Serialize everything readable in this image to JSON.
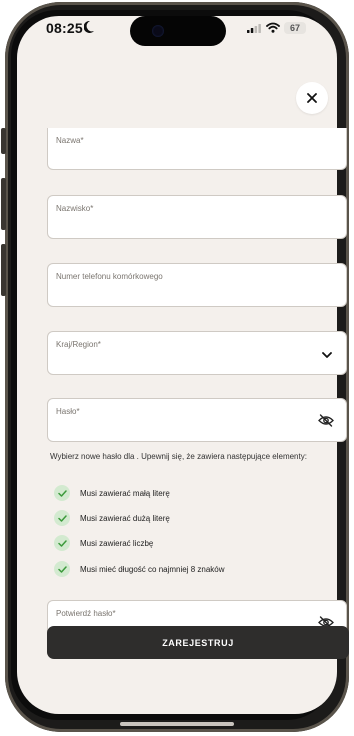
{
  "status_bar": {
    "time": "08:25",
    "battery": "67"
  },
  "form": {
    "first_name_label": "Nazwa*",
    "last_name_label": "Nazwisko*",
    "phone_label": "Numer telefonu komórkowego",
    "country_label": "Kraj/Region*",
    "password_label": "Hasło*",
    "confirm_password_label": "Potwierdź hasło*"
  },
  "password_rules": {
    "instructions": "Wybierz nowe hasło dla . Upewnij się, że zawiera następujące elementy:",
    "items": [
      {
        "label": "Musi zawierać małą literę",
        "met": true
      },
      {
        "label": "Musi zawierać dużą literę",
        "met": true
      },
      {
        "label": "Musi zawierać liczbę",
        "met": true
      },
      {
        "label": "Musi mieć długość co najmniej 8 znaków",
        "met": true
      }
    ]
  },
  "submit_label": "ZAREJESTRUJ",
  "colors": {
    "background": "#f4f0ec",
    "button": "#2e2d2c",
    "check_bg": "#d3ead0",
    "check_mark": "#3c9a3c"
  }
}
